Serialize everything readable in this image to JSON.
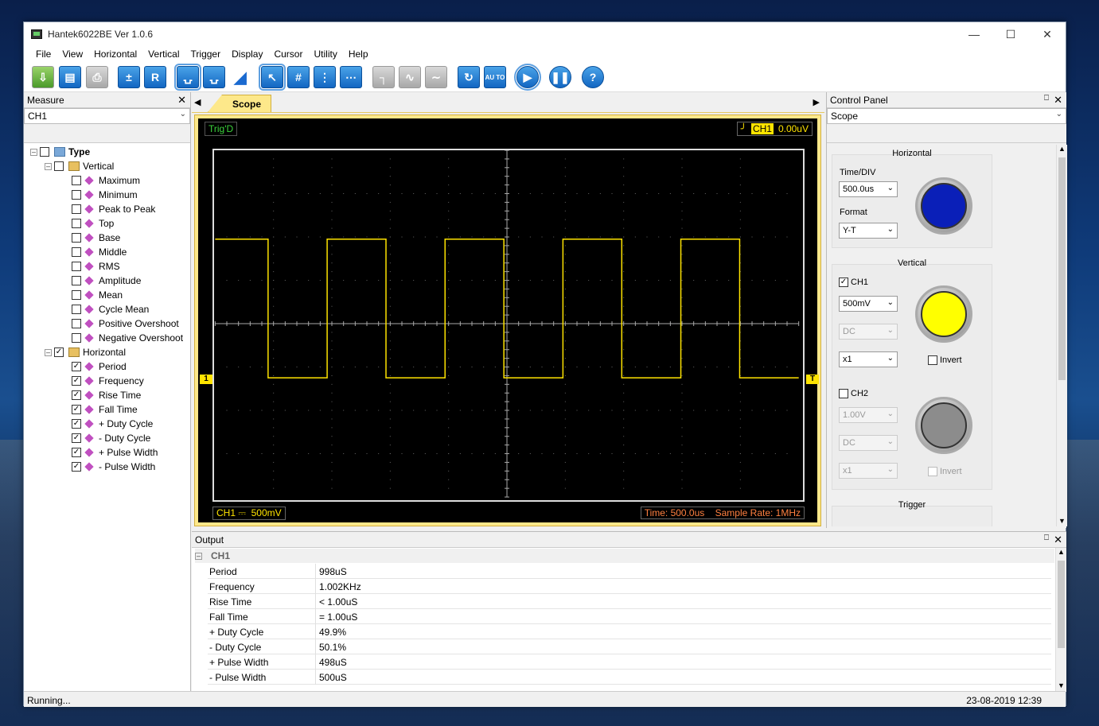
{
  "window": {
    "title": "Hantek6022BE Ver 1.0.6"
  },
  "menu": [
    "File",
    "View",
    "Horizontal",
    "Vertical",
    "Trigger",
    "Display",
    "Cursor",
    "Utility",
    "Help"
  ],
  "toolbar": {
    "r_label": "R",
    "auto_label": "AU TO",
    "help_label": "?"
  },
  "measure_panel": {
    "title": "Measure",
    "channel": "CH1",
    "root": "Type",
    "vertical_label": "Vertical",
    "vertical_items": [
      "Maximum",
      "Minimum",
      "Peak to Peak",
      "Top",
      "Base",
      "Middle",
      "RMS",
      "Amplitude",
      "Mean",
      "Cycle Mean",
      "Positive Overshoot",
      "Negative Overshoot"
    ],
    "horizontal_label": "Horizontal",
    "horizontal_items": [
      "Period",
      "Frequency",
      "Rise Time",
      "Fall Time",
      "+ Duty Cycle",
      "- Duty Cycle",
      "+ Pulse Width",
      "- Pulse Width"
    ]
  },
  "scope": {
    "tab": "Scope",
    "trig_status": "Trig'D",
    "trig_channel": "CH1",
    "trig_level": "0.00uV",
    "channel_label": "CH1",
    "channel_coupling": "⎓",
    "volt_div": "500mV",
    "time_label": "Time: 500.0us",
    "sample_rate": "Sample Rate: 1MHz",
    "ch_marker": "1",
    "trig_marker": "T",
    "wave": {
      "periods_per_screen": 4.95,
      "high_div": 1.95,
      "low_div": -1.25,
      "start_phase": 0.05,
      "duty": 0.499,
      "color": "#ffe400"
    }
  },
  "control_panel": {
    "title": "Control Panel",
    "mode": "Scope",
    "horizontal": {
      "title": "Horizontal",
      "time_div_label": "Time/DIV",
      "time_div": "500.0us",
      "format_label": "Format",
      "format": "Y-T"
    },
    "vertical": {
      "title": "Vertical",
      "ch1_label": "CH1",
      "ch1_volt": "500mV",
      "ch1_coupling": "DC",
      "ch1_probe": "x1",
      "invert_label": "Invert",
      "ch2_label": "CH2",
      "ch2_volt": "1.00V",
      "ch2_coupling": "DC",
      "ch2_probe": "x1"
    },
    "trigger": {
      "title": "Trigger"
    },
    "knob_colors": {
      "horizontal": "#0a1fb8",
      "ch1": "#ffff00",
      "ch2": "#8c8c8c"
    }
  },
  "output": {
    "title": "Output",
    "channel": "CH1",
    "rows": [
      {
        "k": "Period",
        "v": "998uS"
      },
      {
        "k": "Frequency",
        "v": "1.002KHz"
      },
      {
        "k": "Rise Time",
        "v": "< 1.00uS"
      },
      {
        "k": "Fall Time",
        "v": "= 1.00uS"
      },
      {
        "k": "+ Duty Cycle",
        "v": "49.9%"
      },
      {
        "k": "- Duty Cycle",
        "v": "50.1%"
      },
      {
        "k": "+ Pulse Width",
        "v": "498uS"
      },
      {
        "k": "- Pulse Width",
        "v": "500uS"
      }
    ]
  },
  "status": {
    "left": "Running...",
    "right": "23-08-2019 12:39"
  }
}
